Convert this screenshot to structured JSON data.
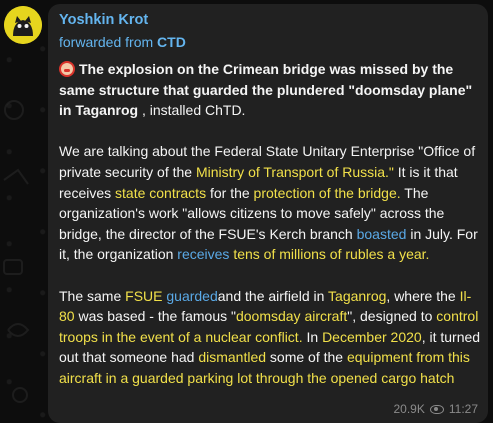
{
  "message": {
    "author": "Yoshkin Krot",
    "forwarded_prefix": "forwarded from ",
    "forwarded_source": "CTD",
    "views": "20.9K",
    "time": "11:27",
    "avatar_icon": "cat-avatar-icon",
    "emoji_icon": "face-emoji-icon",
    "view_icon": "eye-icon"
  },
  "p1": {
    "s1": "The explosion on the Crimean bridge was missed by the same structure that guarded the plundered \"doomsday plane\" in Taganrog",
    "s2": " , installed ChTD."
  },
  "p2": {
    "s1": "We are talking about the Federal State Unitary Enterprise \"Office of private security of the ",
    "s2": "Ministry of Transport of Russia.\"",
    "s3": " It is it that receives ",
    "s4": "state contracts",
    "s5": " for the ",
    "s6": "protection of the bridge.",
    "s7": " The organization's work \"allows citizens to move safely\" across the bridge, the director of the FSUE's Kerch branch ",
    "s8": "boasted",
    "s9": " in July. For it, the organization ",
    "s10": "receives",
    "s11": " ",
    "s12": "tens of millions of rubles a year."
  },
  "p3": {
    "s1": "The same ",
    "s2": "FSUE",
    "s3": " ",
    "s4": "guarded",
    "s5": "and the airfield in ",
    "s6": "Taganrog",
    "s7": ", where the ",
    "s8": "Il-80",
    "s9": " was based - the famous \"",
    "s10": "doomsday aircraft",
    "s11": "\", designed to ",
    "s12": "control troops in the event of a nuclear conflict.",
    "s13": " In ",
    "s14": "December 2020",
    "s15": ", it turned out that someone had ",
    "s16": "dismantled",
    "s17": " some of the ",
    "s18": "equipment from this aircraft in a guarded parking lot through the opened cargo hatch"
  }
}
